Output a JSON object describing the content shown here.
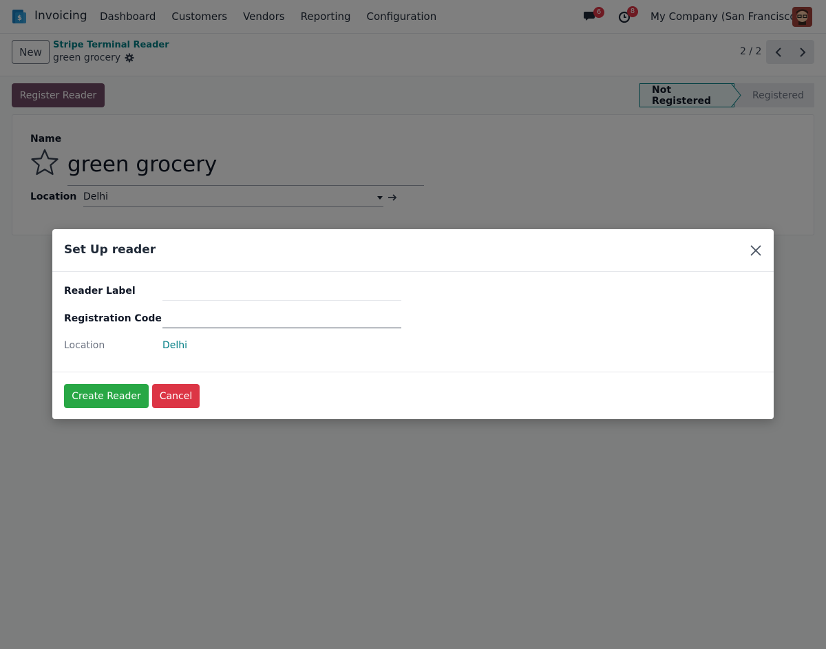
{
  "navbar": {
    "app_name": "Invoicing",
    "menu": [
      "Dashboard",
      "Customers",
      "Vendors",
      "Reporting",
      "Configuration"
    ],
    "messages_count": "6",
    "activities_count": "8",
    "company": "My Company (San Francisco)"
  },
  "control_panel": {
    "new_label": "New",
    "breadcrumb_parent": "Stripe Terminal Reader",
    "breadcrumb_current": "green grocery",
    "pager": "2 / 2"
  },
  "form": {
    "register_button": "Register Reader",
    "status": [
      "Not Registered",
      "Registered"
    ],
    "name_label": "Name",
    "name_value": "green grocery",
    "location_label": "Location",
    "location_value": "Delhi"
  },
  "modal": {
    "title": "Set Up reader",
    "reader_label": "Reader Label",
    "reader_label_value": "",
    "registration_code": "Registration Code",
    "registration_code_value": "",
    "location_label": "Location",
    "location_value": "Delhi",
    "create_button": "Create Reader",
    "cancel_button": "Cancel"
  },
  "colors": {
    "brand": "#714b67",
    "link": "#017e84",
    "success": "#28a745",
    "danger": "#dc3545"
  }
}
